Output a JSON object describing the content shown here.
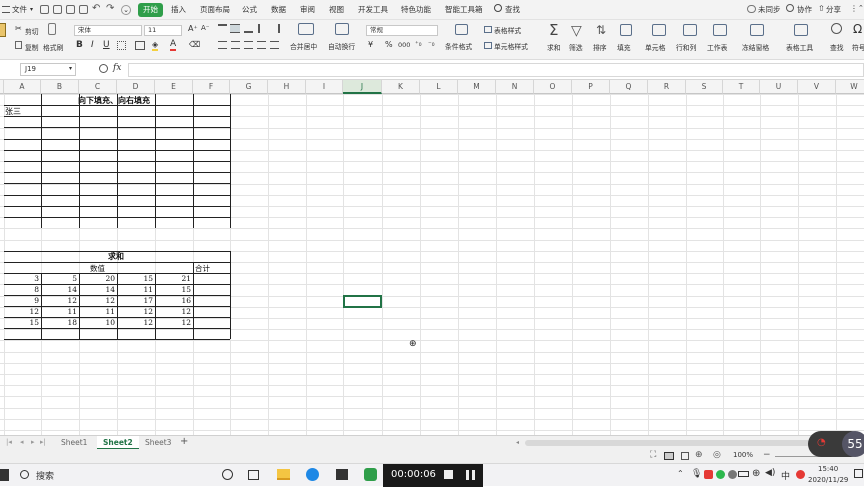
{
  "menubar": {
    "file": "文件",
    "tabs": [
      "开始",
      "插入",
      "页面布局",
      "公式",
      "数据",
      "审阅",
      "视图",
      "开发工具",
      "特色功能",
      "智能工具箱"
    ],
    "search": "查找",
    "sync": "未同步",
    "collab": "协作",
    "share": "分享"
  },
  "ribbon": {
    "cut": "剪切",
    "paste": "粘贴",
    "copy": "复制",
    "format_painter": "格式刷",
    "font_name": "宋体",
    "font_size": "11",
    "bold": "B",
    "italic": "I",
    "underline": "U",
    "font_color": "A",
    "merge_center": "合并居中",
    "wrap_text": "自动换行",
    "number_format": "常规",
    "currency": "¥",
    "percent": "%",
    "thousand": "000",
    "cond_format": "条件格式",
    "table_style": "表格样式",
    "cell_style": "单元格样式",
    "sum": "求和",
    "filter": "筛选",
    "sort": "排序",
    "fill": "填充",
    "cell": "单元格",
    "row_col": "行和列",
    "worksheet": "工作表",
    "freeze": "冻结窗格",
    "table_tools": "表格工具",
    "find": "查找",
    "symbol": "符号"
  },
  "formula_bar": {
    "name_box": "J19",
    "fx": "fx",
    "formula": ""
  },
  "columns": [
    "A",
    "B",
    "C",
    "D",
    "E",
    "F",
    "G",
    "H",
    "I",
    "J",
    "K",
    "L",
    "M",
    "N",
    "O",
    "P",
    "Q",
    "R",
    "S",
    "T",
    "U",
    "V",
    "W"
  ],
  "selected_column": "J",
  "table1": {
    "title": "向下填充、向右填充",
    "first_cell": "张三"
  },
  "table2": {
    "title": "求和",
    "header_values": "数值",
    "header_total": "合计",
    "rows": [
      [
        "3",
        "5",
        "20",
        "15",
        "21"
      ],
      [
        "8",
        "14",
        "14",
        "11",
        "15"
      ],
      [
        "9",
        "12",
        "12",
        "17",
        "16"
      ],
      [
        "12",
        "11",
        "11",
        "12",
        "12"
      ],
      [
        "15",
        "18",
        "10",
        "12",
        "12"
      ]
    ]
  },
  "sheets": [
    "Sheet1",
    "Sheet2",
    "Sheet3"
  ],
  "active_sheet": "Sheet2",
  "add_sheet": "+",
  "status": {
    "zoom": "100%"
  },
  "taskbar": {
    "search": "搜索",
    "recording_time": "00:00:06",
    "time": "15:40",
    "date": "2020/11/29",
    "ime": "中",
    "bubble_number": "55"
  },
  "colors": {
    "accent_green": "#217346",
    "active_tab": "#2f9e4a"
  }
}
